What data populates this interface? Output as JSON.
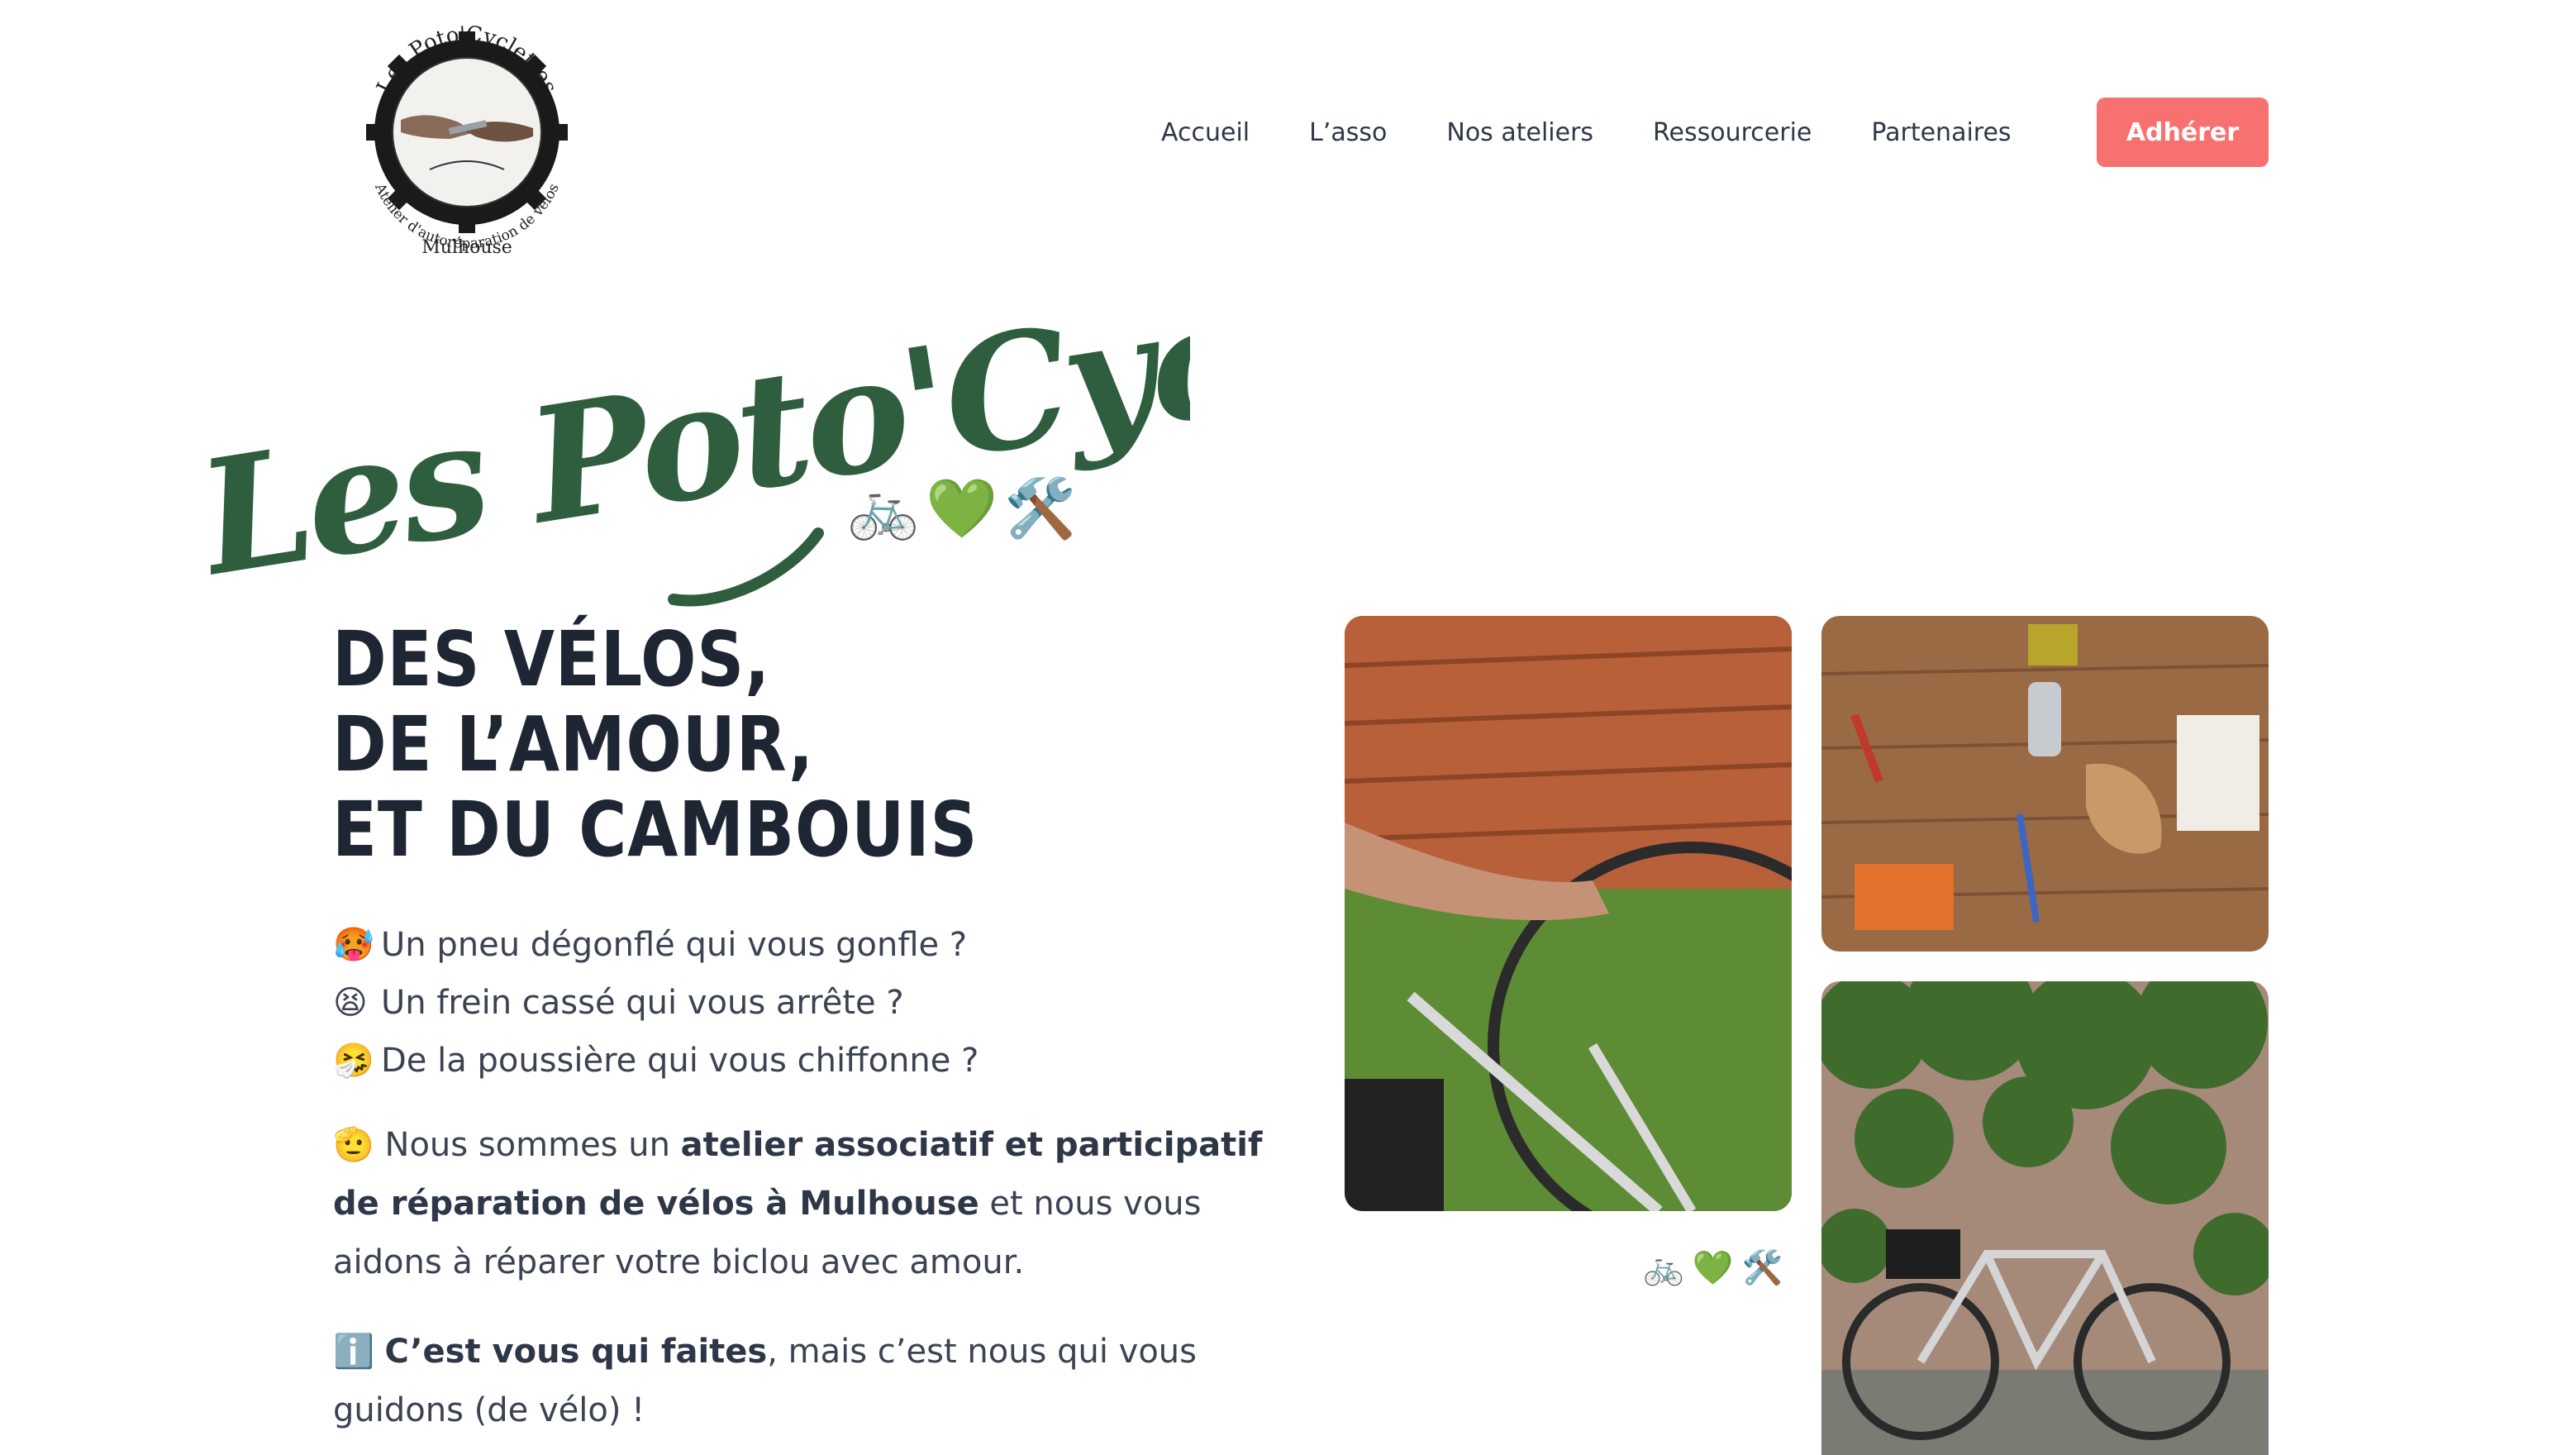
{
  "logo": {
    "arc_text": "Les Poto'Cyclettes",
    "bottom_text": "Atelier d'autoréparation de vélos",
    "city": "Mulhouse"
  },
  "nav": {
    "items": [
      "Accueil",
      "L’asso",
      "Nos ateliers",
      "Ressourcerie",
      "Partenaires"
    ],
    "cta": "Adhérer"
  },
  "hero": {
    "script_title": "Les Poto'Cyclettes",
    "title_emojis": "🚲💚🛠️",
    "headline": [
      "DES VÉLOS,",
      "DE L’AMOUR,",
      "ET DU CAMBOUIS"
    ],
    "questions": [
      {
        "emoji": "🥵",
        "text": "Un pneu dégonflé qui vous gonfle ?"
      },
      {
        "emoji": "😫",
        "text": "Un frein cassé qui vous arrête ?"
      },
      {
        "emoji": "🤧",
        "text": "De la poussière qui vous chiffonne ?"
      }
    ],
    "intro": {
      "emoji": "🫡",
      "before": "Nous sommes un ",
      "bold": "atelier associatif et participatif de réparation de vélos à Mulhouse",
      "after": " et nous vous aidons à réparer votre biclou avec amour."
    },
    "info": {
      "emoji": "ℹ️",
      "bold": "C’est vous qui faites",
      "after": ", mais c’est nous qui vous guidons (de vélo) !"
    }
  },
  "gallery": {
    "caption": "🚲💚🛠️"
  },
  "colors": {
    "brand_green": "#2f5e3f",
    "cta": "#f87171",
    "headline": "#1f2633",
    "text": "#3b4252"
  }
}
